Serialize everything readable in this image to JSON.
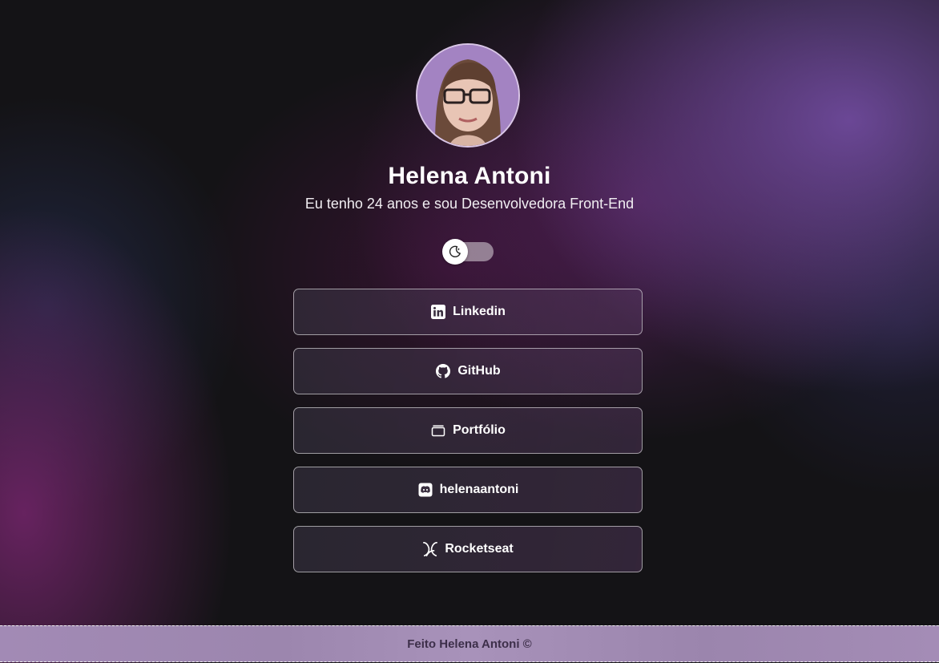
{
  "profile": {
    "name": "Helena Antoni",
    "bio": "Eu tenho 24 anos e sou Desenvolvedora Front-End",
    "avatar_icon": "profile-photo"
  },
  "theme_toggle": {
    "icon": "moon-icon",
    "state": "dark"
  },
  "links": [
    {
      "label": "Linkedin",
      "icon": "linkedin-icon"
    },
    {
      "label": "GitHub",
      "icon": "github-icon"
    },
    {
      "label": "Portfólio",
      "icon": "folder-icon"
    },
    {
      "label": "helenaantoni",
      "icon": "discord-icon"
    },
    {
      "label": "Rocketseat",
      "icon": "rocketseat-icon"
    }
  ],
  "footer": {
    "text": "Feito Helena Antoni ©"
  },
  "colors": {
    "accent": "#a383c2",
    "footer_bg": "#a28ab5",
    "footer_text": "#3d2f4a"
  }
}
